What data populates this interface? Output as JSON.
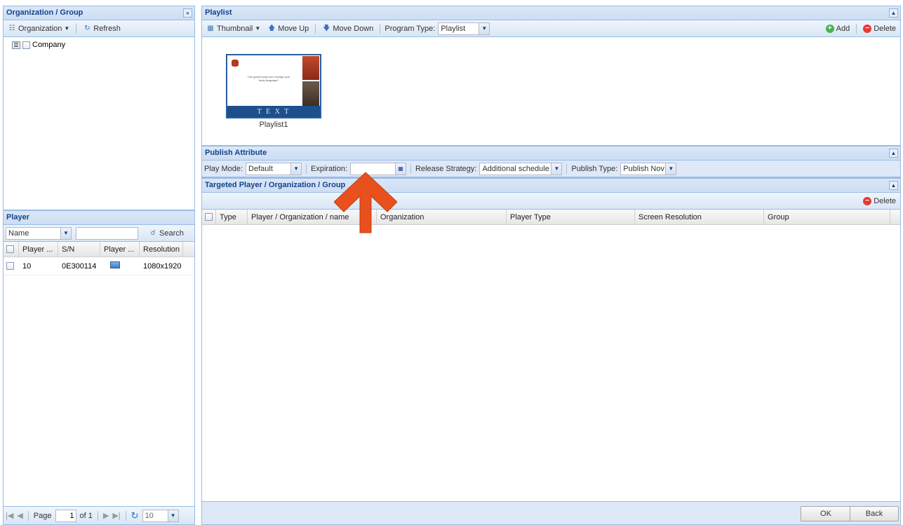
{
  "org_panel": {
    "title": "Organization / Group",
    "collapse_icon": "«",
    "toolbar": {
      "organization_label": "Organization",
      "refresh_label": "Refresh"
    },
    "tree": [
      {
        "label": "Company"
      }
    ]
  },
  "player_panel": {
    "title": "Player",
    "filter": {
      "field_value": "Name",
      "search_value": "",
      "search_label": "Search"
    },
    "columns": [
      "Player ...",
      "S/N",
      "Player ...",
      "Resolution"
    ],
    "rows": [
      {
        "player": "10",
        "sn": "0E300114",
        "resolution": "1080x1920"
      }
    ],
    "pager": {
      "page_label": "Page",
      "page_value": "1",
      "of_label": "of 1",
      "page_size": "10"
    }
  },
  "playlist_panel": {
    "title": "Playlist",
    "toolbar": {
      "thumbnail_label": "Thumbnail",
      "move_up_label": "Move Up",
      "move_down_label": "Move Down",
      "program_type_label": "Program Type:",
      "program_type_value": "Playlist",
      "add_label": "Add",
      "delete_label": "Delete"
    },
    "items": [
      {
        "name": "Playlist1",
        "preview_text": "Can great being ever change your body language?",
        "banner_text": "T E X T"
      }
    ]
  },
  "publish_panel": {
    "title": "Publish Attribute",
    "play_mode_label": "Play Mode:",
    "play_mode_value": "Default",
    "expiration_label": "Expiration:",
    "expiration_value": "",
    "release_strategy_label": "Release Strategy:",
    "release_strategy_value": "Additional schedule",
    "publish_type_label": "Publish Type:",
    "publish_type_value": "Publish Nov"
  },
  "target_panel": {
    "title": "Targeted Player / Organization / Group",
    "delete_label": "Delete",
    "columns": [
      "Type",
      "Player / Organization / name",
      "Organization",
      "Player Type",
      "Screen Resolution",
      "Group"
    ]
  },
  "footer": {
    "ok_label": "OK",
    "back_label": "Back"
  },
  "colors": {
    "header_text": "#15428b",
    "border": "#99bbe8",
    "arrow": "#e8501e"
  }
}
